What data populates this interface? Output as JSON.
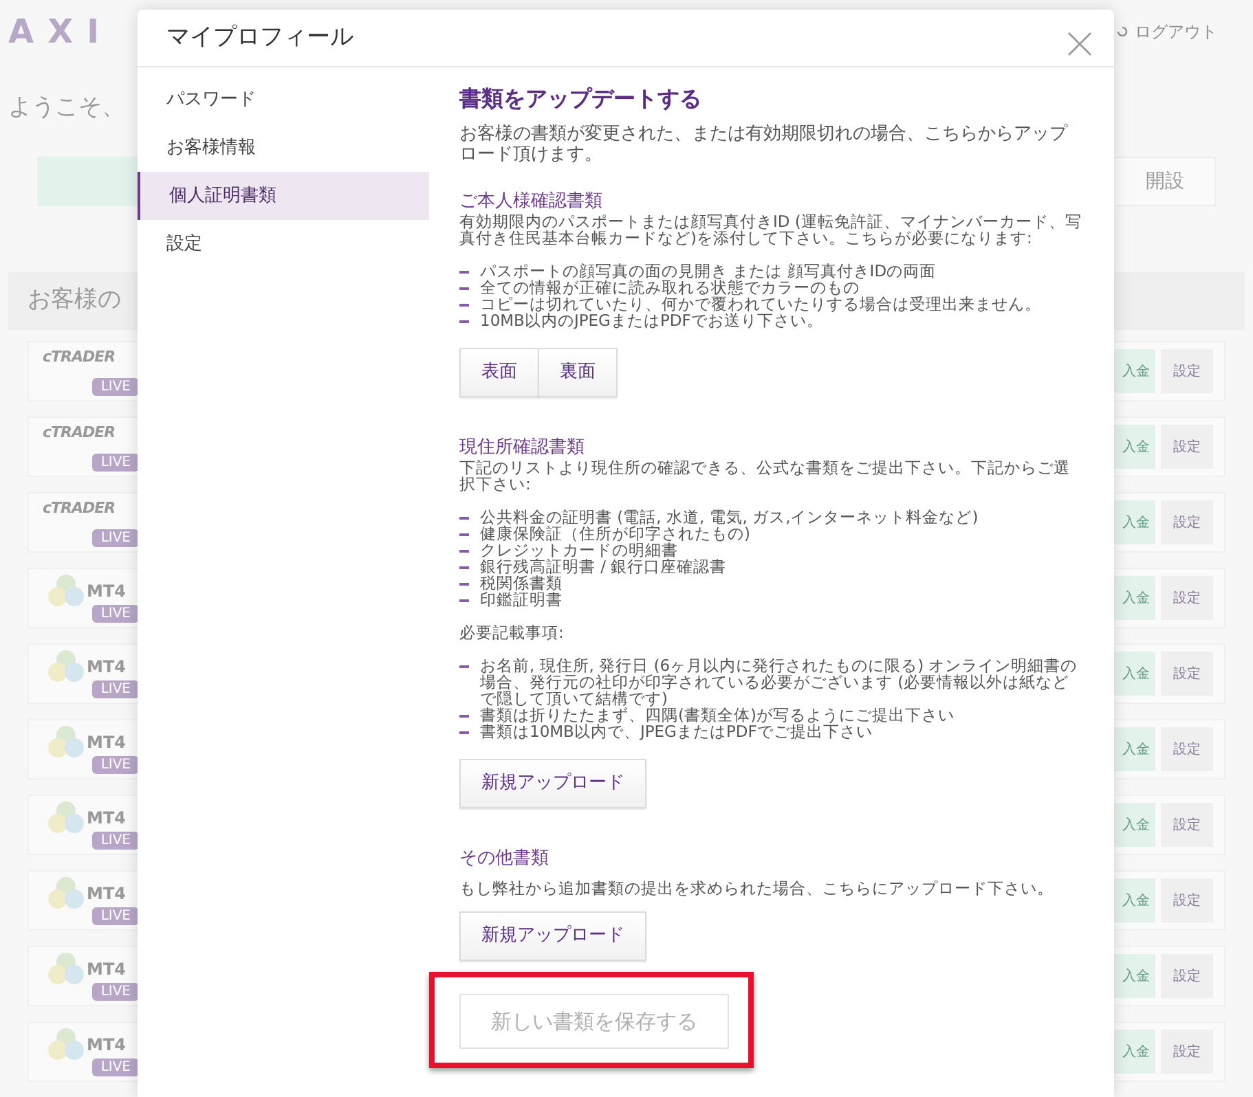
{
  "background": {
    "logo": "AXI",
    "logout": "ログアウト",
    "welcome": "ようこそ、",
    "open_button": "開設",
    "section_title": "お客様の",
    "rows": [
      {
        "kind": "ctrader",
        "logo": "cTRADER",
        "badge": "LIVE",
        "deposit": "入金",
        "settings": "設定"
      },
      {
        "kind": "ctrader",
        "logo": "cTRADER",
        "badge": "LIVE",
        "deposit": "入金",
        "settings": "設定"
      },
      {
        "kind": "ctrader",
        "logo": "cTRADER",
        "badge": "LIVE",
        "deposit": "入金",
        "settings": "設定"
      },
      {
        "kind": "mt4",
        "logo": "MT4",
        "badge": "LIVE",
        "deposit": "入金",
        "settings": "設定"
      },
      {
        "kind": "mt4",
        "logo": "MT4",
        "badge": "LIVE",
        "deposit": "入金",
        "settings": "設定"
      },
      {
        "kind": "mt4",
        "logo": "MT4",
        "badge": "LIVE",
        "deposit": "入金",
        "settings": "設定"
      },
      {
        "kind": "mt4",
        "logo": "MT4",
        "badge": "LIVE",
        "deposit": "入金",
        "settings": "設定"
      },
      {
        "kind": "mt4",
        "logo": "MT4",
        "badge": "LIVE",
        "deposit": "入金",
        "settings": "設定"
      },
      {
        "kind": "mt4",
        "logo": "MT4",
        "badge": "LIVE",
        "deposit": "入金",
        "settings": "設定"
      },
      {
        "kind": "mt4",
        "logo": "MT4",
        "badge": "LIVE",
        "deposit": "入金",
        "settings": "設定"
      }
    ]
  },
  "dialog": {
    "title": "マイプロフィール",
    "sidebar": {
      "items": [
        {
          "label": "パスワード",
          "selected": false
        },
        {
          "label": "お客様情報",
          "selected": false
        },
        {
          "label": "個人証明書類",
          "selected": true
        },
        {
          "label": "設定",
          "selected": false
        }
      ]
    },
    "heading": "書類をアップデートする",
    "intro": "お客様の書類が変更された、または有効期限切れの場合、こちらからアップロード頂けます。",
    "sections": [
      {
        "heading": "ご本人様確認書類",
        "description": "有効期限内のパスポートまたは顔写真付きID (運転免許証、マイナンバーカード、写真付き住民基本台帳カードなど)を添付して下さい。こちらが必要になります:",
        "items": [
          "パスポートの顔写真の面の見開き または 顔写真付きIDの両面",
          "全ての情報が正確に読み取れる状態でカラーのもの",
          "コピーは切れていたり、何かで覆われていたりする場合は受理出来ません。",
          "10MB以内のJPEGまたはPDFでお送り下さい。"
        ],
        "buttons": [
          "表面",
          "裏面"
        ]
      },
      {
        "heading": "現住所確認書類",
        "description": "下記のリストより現住所の確認できる、公式な書類をご提出下さい。下記からご選択下さい:",
        "items": [
          "公共料金の証明書 (電話, 水道, 電気, ガス,インターネット料金など)",
          "健康保険証（住所が印字されたもの)",
          "クレジットカードの明細書",
          "銀行残高証明書 / 銀行口座確認書",
          "税関係書類",
          "印鑑証明書"
        ],
        "requirements_label": "必要記載事項:",
        "requirements": [
          "お名前, 現住所, 発行日 (6ヶ月以内に発行されたものに限る) オンライン明細書の場合、発行元の社印が印字されている必要がございます (必要情報以外は紙などで隠して頂いて結構です)",
          "書類は折りたたまず、四隅(書類全体)が写るようにご提出下さい",
          "書類は10MB以内で、JPEGまたはPDFでご提出下さい"
        ],
        "buttons": [
          "新規アップロード"
        ]
      },
      {
        "heading": "その他書類",
        "description": "もし弊社から追加書類の提出を求められた場合、こちらにアップロード下さい。",
        "buttons": [
          "新規アップロード"
        ]
      }
    ],
    "save_button": {
      "label": "新しい書類を保存する",
      "disabled": true,
      "highlighted": true
    }
  }
}
